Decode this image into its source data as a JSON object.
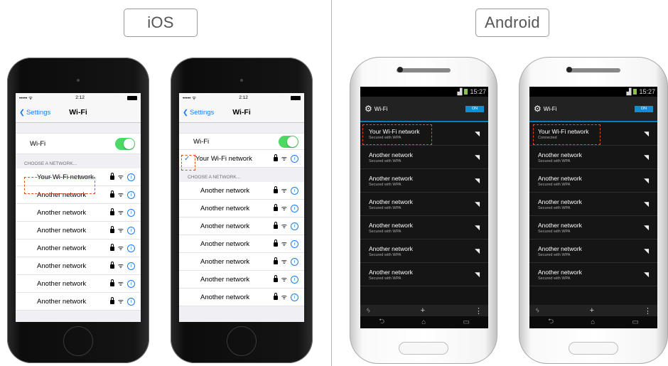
{
  "labels": {
    "ios": "iOS",
    "android": "Android"
  },
  "ios_a": {
    "status": {
      "carrier": "••••• ᯤ",
      "time": "2:12"
    },
    "back": "Settings",
    "title": "Wi-Fi",
    "wifi_label": "Wi-Fi",
    "section": "CHOOSE A NETWORK...",
    "networks": [
      "Your Wi-Fi network",
      "Another network",
      "Another network",
      "Another network",
      "Another network",
      "Another network",
      "Another network",
      "Another network"
    ]
  },
  "ios_b": {
    "status": {
      "carrier": "••••• ᯤ",
      "time": "2:12"
    },
    "back": "Settings",
    "title": "Wi-Fi",
    "wifi_label": "Wi-Fi",
    "connected": "Your Wi-Fi network",
    "section": "CHOOSE A NETWORK...",
    "networks": [
      "Another network",
      "Another network",
      "Another network",
      "Another network",
      "Another network",
      "Another network",
      "Another network"
    ]
  },
  "android_a": {
    "status_time": "15:27",
    "title": "Wi-Fi",
    "switch": "ON",
    "networks": [
      {
        "name": "Your Wi-Fi network",
        "sub": "Secured with WPA"
      },
      {
        "name": "Another network",
        "sub": "Secured with WPA"
      },
      {
        "name": "Another network",
        "sub": "Secured with WPA"
      },
      {
        "name": "Another network",
        "sub": "Secured with WPA"
      },
      {
        "name": "Another network",
        "sub": "Secured with WPA"
      },
      {
        "name": "Another network",
        "sub": "Secured with WPA"
      },
      {
        "name": "Another network",
        "sub": "Secured with WPA"
      }
    ]
  },
  "android_b": {
    "status_time": "15:27",
    "title": "Wi-Fi",
    "switch": "ON",
    "networks": [
      {
        "name": "Your Wi-Fi network",
        "sub": "Connected"
      },
      {
        "name": "Another network",
        "sub": "Secured with WPA"
      },
      {
        "name": "Another network",
        "sub": "Secured with WPA"
      },
      {
        "name": "Another network",
        "sub": "Secured with WPA"
      },
      {
        "name": "Another network",
        "sub": "Secured with WPA"
      },
      {
        "name": "Another network",
        "sub": "Secured with WPA"
      },
      {
        "name": "Another network",
        "sub": "Secured with WPA"
      }
    ]
  },
  "colors": {
    "ios_blue": "#157efb",
    "ios_green": "#4cd964",
    "highlight": "#e74c1c",
    "android_blue": "#0e8ed6"
  }
}
